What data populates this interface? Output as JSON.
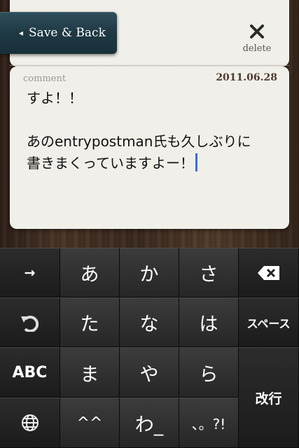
{
  "header": {
    "save_back_label": "Save & Back",
    "delete_label": "delete",
    "delete_icon": "close-icon"
  },
  "note": {
    "section_label": "comment",
    "date": "2011.06.28",
    "body": "すよ！！\n\nあのentrypostman氏も久しぶりに\n書きまくっていますよー！"
  },
  "keyboard": {
    "row1": {
      "left": "→",
      "k1": "あ",
      "k2": "か",
      "k3": "さ",
      "right_icon": "backspace-icon"
    },
    "row2": {
      "left_icon": "undo-icon",
      "k1": "た",
      "k2": "な",
      "k3": "は",
      "right": "スペース"
    },
    "row3": {
      "left": "ABC",
      "k1": "ま",
      "k2": "や",
      "k3": "ら",
      "right": "改行"
    },
    "row4": {
      "left_icon": "globe-icon",
      "k1": "^^",
      "k2": "わ_",
      "k3": "、。?!"
    }
  },
  "colors": {
    "save_button_bg": "#1f3944",
    "note_bg": "#f1efe9",
    "caret": "#3e6de0",
    "keyboard_bg": "#1a1a1a"
  }
}
